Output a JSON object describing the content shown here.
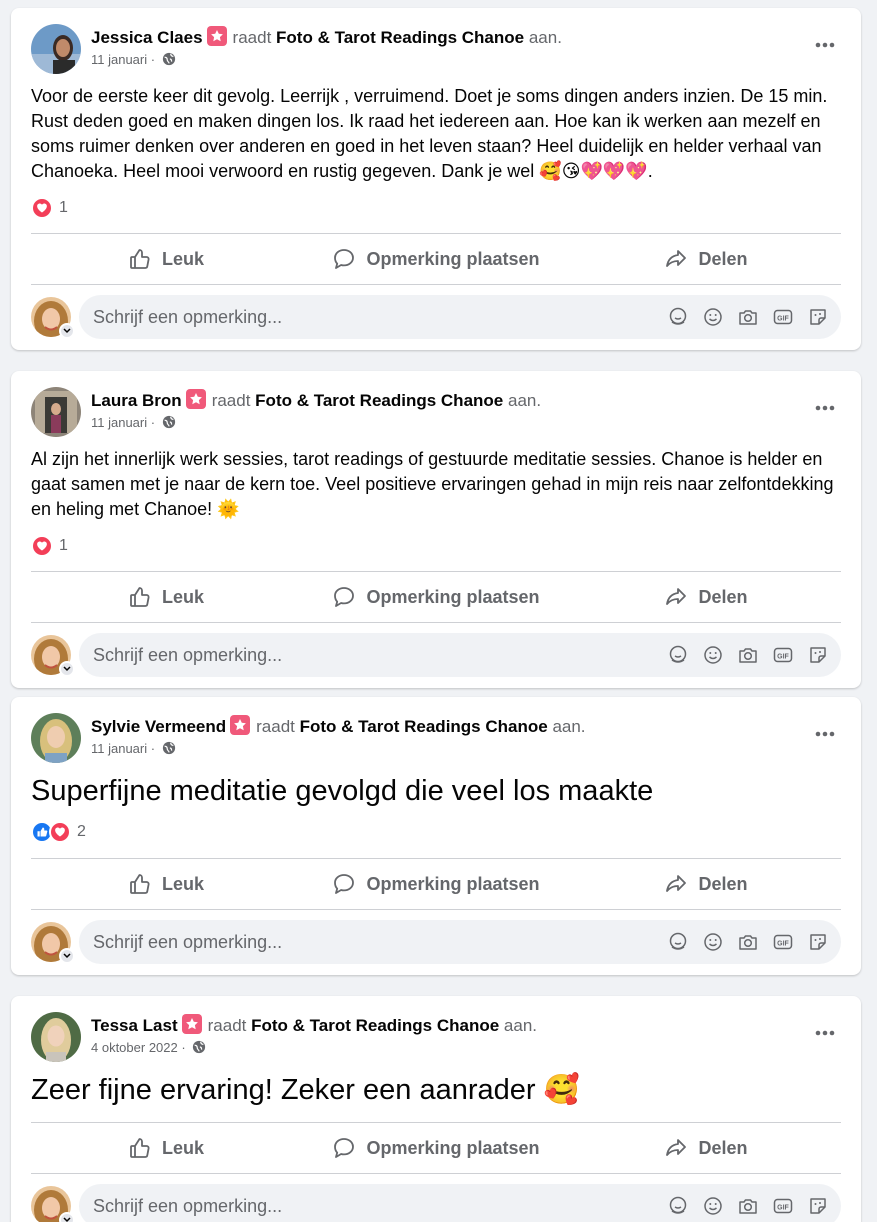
{
  "common": {
    "verb": "raadt",
    "page_name": "Foto & Tarot Readings Chanoe",
    "suffix": "aan.",
    "like_label": "Leuk",
    "comment_label": "Opmerking plaatsen",
    "share_label": "Delen",
    "comment_placeholder": "Schrijf een opmerking...",
    "date_sep": " ·"
  },
  "posts": [
    {
      "author": "Jessica Claes",
      "date": "11 januari",
      "text": "Voor de eerste keer dit gevolg. Leerrijk , verruimend. Doet je soms dingen anders inzien. De 15 min. Rust deden goed en maken dingen los. Ik raad het iedereen aan. Hoe kan ik werken aan mezelf en soms ruimer denken over anderen en goed in het leven staan? Heel duidelijk en helder verhaal van Chanoeka. Heel mooi verwoord en rustig gegeven. Dank je wel 🥰😘💖💖💖.",
      "reaction_count": "1",
      "reactions": [
        "love"
      ]
    },
    {
      "author": "Laura Bron",
      "date": "11 januari",
      "text": "Al zijn het innerlijk werk sessies, tarot readings of gestuurde meditatie sessies. Chanoe is helder en gaat samen met je naar de kern toe.  Veel positieve ervaringen gehad in mijn reis naar zelfontdekking en heling met Chanoe! 🌞",
      "reaction_count": "1",
      "reactions": [
        "love"
      ]
    },
    {
      "author": "Sylvie Vermeend",
      "date": "11 januari",
      "text": "Superfijne meditatie gevolgd die veel los maakte",
      "reaction_count": "2",
      "reactions": [
        "like",
        "love"
      ]
    },
    {
      "author": "Tessa Last",
      "date": "4 oktober 2022",
      "text": "Zeer fijne ervaring! Zeker een aanrader 🥰",
      "reaction_count": "",
      "reactions": []
    }
  ],
  "colors": {
    "badge": "#f0597a",
    "love": "#f33e58",
    "like": "#1877f2",
    "muted_text": "#65676b"
  },
  "icons": [
    "globe-icon",
    "more-options-icon",
    "thumbs-up-icon",
    "comment-icon",
    "share-icon",
    "heart-icon",
    "sticker-icon",
    "emoji-icon",
    "camera-icon",
    "gif-icon",
    "avatar-sticker-icon",
    "recommend-badge-icon"
  ]
}
